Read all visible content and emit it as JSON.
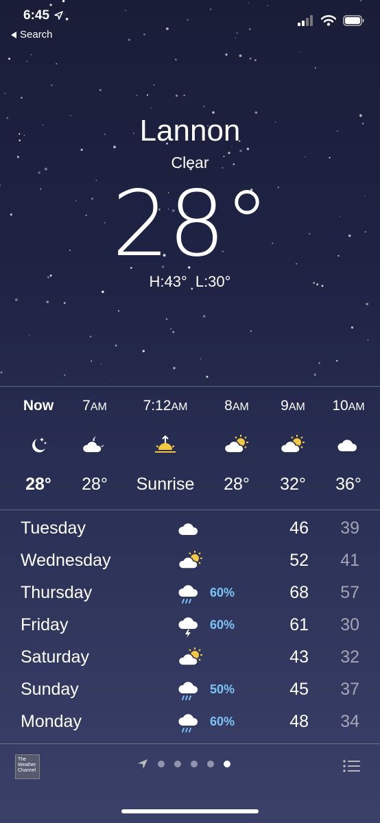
{
  "status": {
    "time": "6:45",
    "back_label": "Search"
  },
  "location": {
    "city": "Lannon",
    "condition": "Clear",
    "temperature": "28°",
    "high": "H:43°",
    "low": "L:30°"
  },
  "hourly": [
    {
      "time": "Now",
      "icon": "moon-stars-icon",
      "temp": "28°"
    },
    {
      "time": "7",
      "suffix": "AM",
      "icon": "cloud-moon-icon",
      "temp": "28°"
    },
    {
      "time": "7:12",
      "suffix": "AM",
      "icon": "sunrise-icon",
      "temp": "Sunrise"
    },
    {
      "time": "8",
      "suffix": "AM",
      "icon": "cloud-sun-icon",
      "temp": "28°"
    },
    {
      "time": "9",
      "suffix": "AM",
      "icon": "cloud-sun-icon",
      "temp": "32°"
    },
    {
      "time": "10",
      "suffix": "AM",
      "icon": "cloud-icon",
      "temp": "36°"
    }
  ],
  "daily": [
    {
      "day": "Tuesday",
      "icon": "cloud-icon",
      "pop": "",
      "high": "46",
      "low": "39"
    },
    {
      "day": "Wednesday",
      "icon": "cloud-sun-icon",
      "pop": "",
      "high": "52",
      "low": "41"
    },
    {
      "day": "Thursday",
      "icon": "cloud-rain-icon",
      "pop": "60%",
      "high": "68",
      "low": "57"
    },
    {
      "day": "Friday",
      "icon": "cloud-bolt-icon",
      "pop": "60%",
      "high": "61",
      "low": "30"
    },
    {
      "day": "Saturday",
      "icon": "cloud-sun-icon",
      "pop": "",
      "high": "43",
      "low": "32"
    },
    {
      "day": "Sunday",
      "icon": "cloud-rain-icon",
      "pop": "50%",
      "high": "45",
      "low": "37"
    },
    {
      "day": "Monday",
      "icon": "cloud-rain-icon",
      "pop": "60%",
      "high": "48",
      "low": "34"
    }
  ],
  "footer": {
    "logo_text": "The Weather Channel",
    "pages": 5,
    "current_page": 5
  },
  "colors": {
    "pop": "#7cc4f5",
    "sun": "#f5c842",
    "background": "#1f2445"
  }
}
